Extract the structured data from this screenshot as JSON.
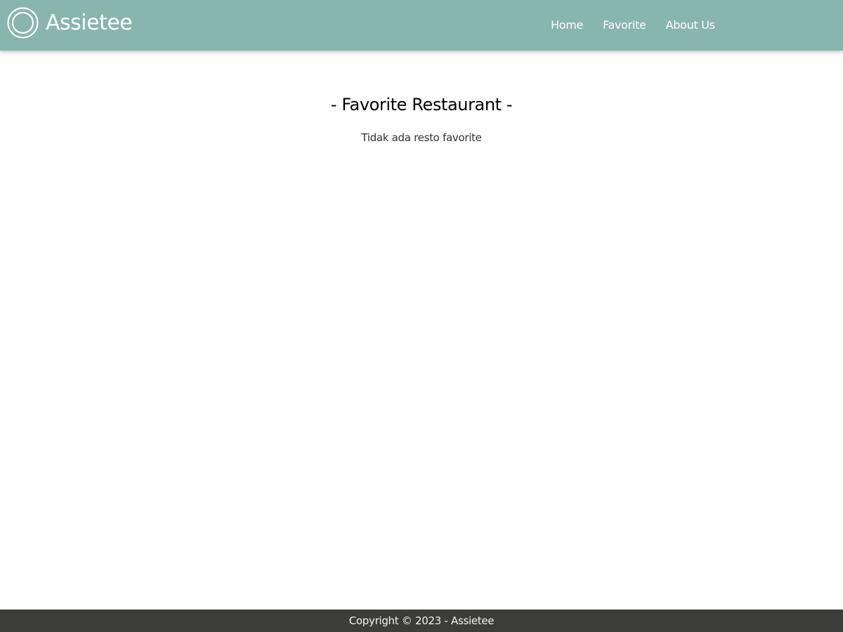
{
  "colors": {
    "header_background": "#88b5ae",
    "footer_background": "#3c3d3b",
    "header_text": "#ffffff",
    "page_background": "#ffffff"
  },
  "header": {
    "logo_icon": "double-ring-icon",
    "brand_name": "Assietee",
    "nav": [
      {
        "label": "Home"
      },
      {
        "label": "Favorite"
      },
      {
        "label": "About Us"
      }
    ]
  },
  "main": {
    "title": "- Favorite Restaurant -",
    "empty_message": "Tidak ada resto favorite"
  },
  "footer": {
    "copyright": "Copyright © 2023 - Assietee"
  }
}
